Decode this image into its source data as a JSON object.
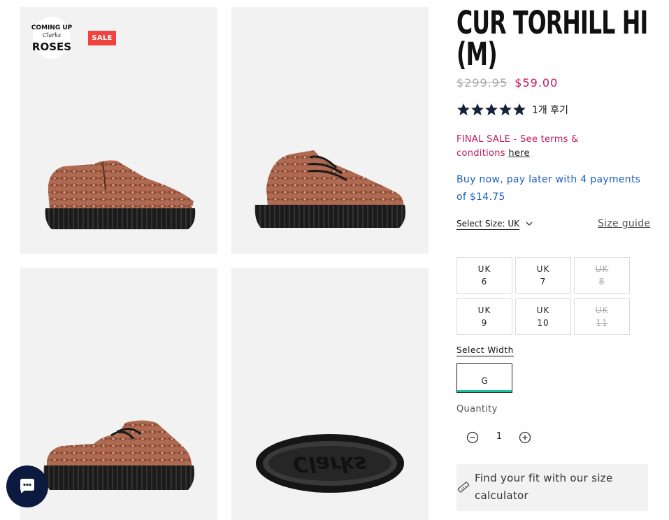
{
  "gallery": {
    "sale_badge": "SALE",
    "logo_alt_text": "COMING UP ROSES Clarks"
  },
  "product": {
    "title_line1": "CUR TORHILL HI",
    "title_line2": "(M)",
    "price_original": "$299.95",
    "price_sale": "$59.00",
    "rating": 5,
    "reviews": "1개 후기",
    "final_sale_text": "FINAL SALE - See terms & conditions",
    "final_sale_link": "here",
    "pay_later": "Buy now, pay later with 4 payments of $14.75"
  },
  "size": {
    "select_label": "Select Size: UK",
    "guide_label": "Size guide",
    "options": [
      {
        "region": "UK",
        "size": "6",
        "available": true
      },
      {
        "region": "UK",
        "size": "7",
        "available": true
      },
      {
        "region": "UK",
        "size": "8",
        "available": false
      },
      {
        "region": "UK",
        "size": "9",
        "available": true
      },
      {
        "region": "UK",
        "size": "10",
        "available": true
      },
      {
        "region": "UK",
        "size": "11",
        "available": false
      }
    ]
  },
  "width": {
    "label": "Select Width",
    "selected": "G"
  },
  "quantity": {
    "label": "Quantity",
    "value": "1"
  },
  "fit": {
    "text": "Find your fit with our size calculator"
  },
  "colors": {
    "sale_red": "#c2185b",
    "badge_red": "#f0433d",
    "paylater_blue": "#1f5fbf",
    "width_accent": "#1fbfa5",
    "chat_navy": "#0c1a3f"
  },
  "icons": [
    "star-icon",
    "chevron-down-icon",
    "minus-circle-icon",
    "plus-circle-icon",
    "ruler-icon",
    "chat-icon"
  ]
}
